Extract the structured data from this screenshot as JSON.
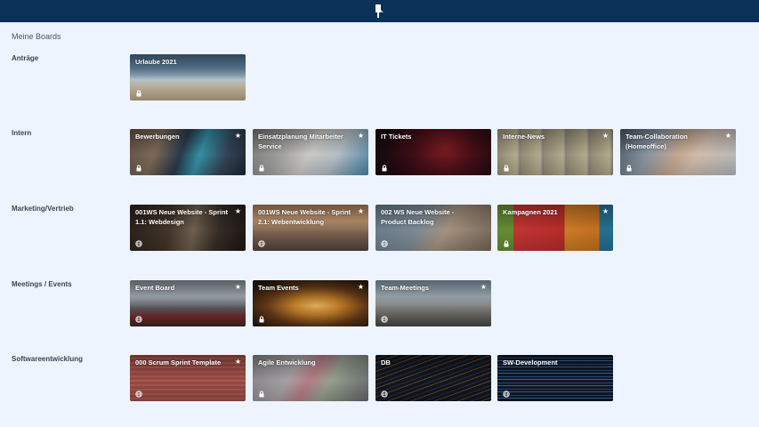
{
  "header": {
    "logo_icon": "app-logo-icon"
  },
  "page_title": "Meine Boards",
  "sections": [
    {
      "name": "antraege",
      "label": "Anträge",
      "boards": [
        {
          "name": "urlaube-2021",
          "title": "Urlaube 2021",
          "status_icon": "lock-icon",
          "starred": false
        }
      ]
    },
    {
      "name": "intern",
      "label": "Intern",
      "boards": [
        {
          "name": "bewerbungen",
          "title": "Bewerbungen",
          "status_icon": "lock-icon",
          "starred": true
        },
        {
          "name": "einsatzplanung",
          "title": "Einsatzplanung Mitarbeiter Service",
          "status_icon": "lock-icon",
          "starred": true
        },
        {
          "name": "it-tickets",
          "title": "IT Tickets",
          "status_icon": "lock-icon",
          "starred": false
        },
        {
          "name": "interne-news",
          "title": "Interne-News",
          "status_icon": "lock-icon",
          "starred": true
        },
        {
          "name": "team-collaboration",
          "title": "Team-Collaboration (Homeoffice)",
          "status_icon": "lock-icon",
          "starred": true
        }
      ]
    },
    {
      "name": "marketing",
      "label": "Marketing/Vertrieb",
      "boards": [
        {
          "name": "001ws-sprint-1-1",
          "title": "001WS Neue Website - Sprint 1.1: Webdesign",
          "status_icon": "globe-icon",
          "starred": true
        },
        {
          "name": "001ws-sprint-2-1",
          "title": "001WS Neue Website - Sprint 2.1: Webentwicklung",
          "status_icon": "globe-icon",
          "starred": true
        },
        {
          "name": "002ws-backlog",
          "title": "002 WS Neue Website - Product Backlog",
          "status_icon": "globe-icon",
          "starred": false
        },
        {
          "name": "kampagnen-2021",
          "title": "Kampagnen 2021",
          "status_icon": "lock-icon",
          "starred": true
        }
      ]
    },
    {
      "name": "meetings",
      "label": "Meetings / Events",
      "boards": [
        {
          "name": "event-board",
          "title": "Event Board",
          "status_icon": "globe-icon",
          "starred": true
        },
        {
          "name": "team-events",
          "title": "Team Events",
          "status_icon": "lock-icon",
          "starred": true
        },
        {
          "name": "team-meetings",
          "title": "Team-Meetings",
          "status_icon": "globe-icon",
          "starred": true
        }
      ]
    },
    {
      "name": "softwareentwicklung",
      "label": "Softwareentwicklung",
      "boards": [
        {
          "name": "scrum-sprint-template",
          "title": "000 Scrum Sprint Template",
          "status_icon": "globe-icon",
          "starred": true
        },
        {
          "name": "agile-entwicklung",
          "title": "Agile Entwicklung",
          "status_icon": "lock-icon",
          "starred": false
        },
        {
          "name": "db",
          "title": "DB",
          "status_icon": "globe-icon",
          "starred": false
        },
        {
          "name": "sw-development",
          "title": "SW-Development",
          "status_icon": "globe-icon",
          "starred": false
        }
      ]
    }
  ],
  "star_glyph": "★"
}
